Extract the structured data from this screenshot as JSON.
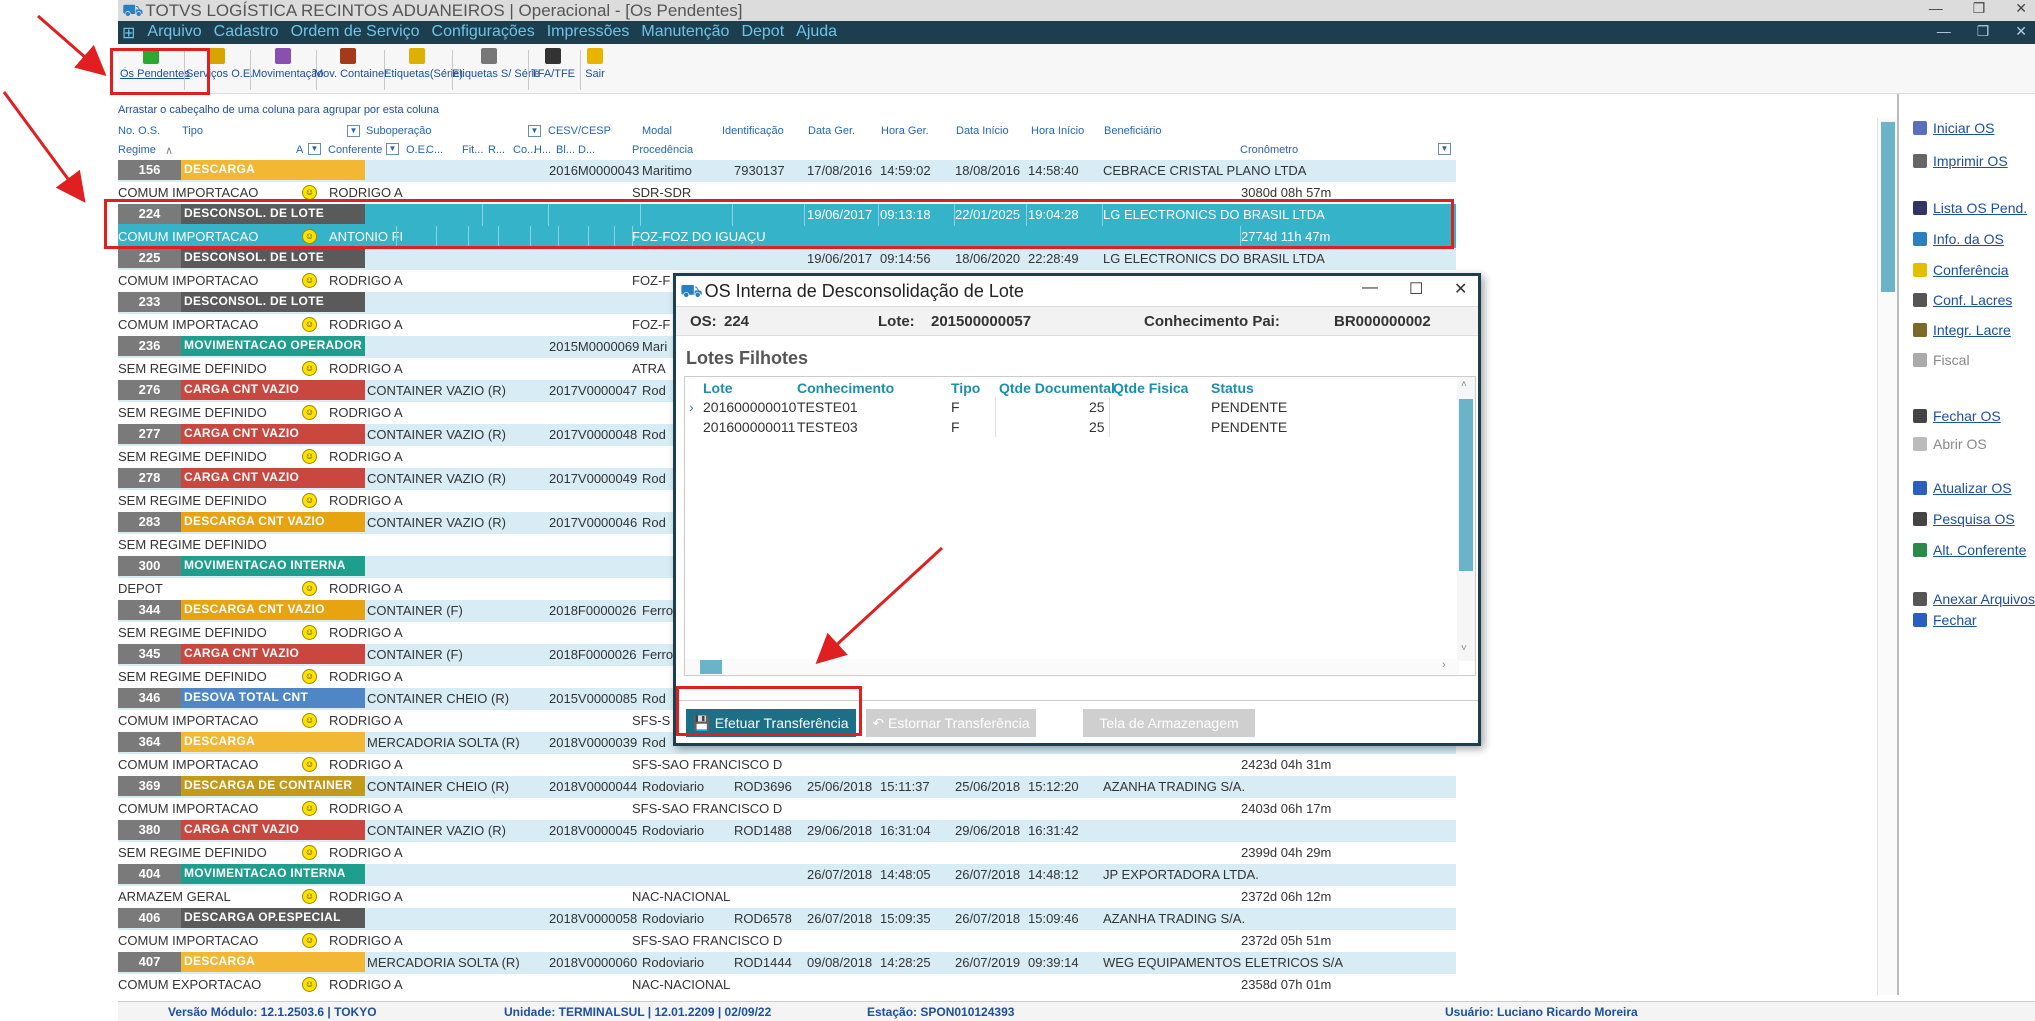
{
  "window": {
    "title": "TOTVS LOGÍSTICA RECINTOS ADUANEIROS | Operacional - [Os Pendentes]"
  },
  "menu": [
    "Arquivo",
    "Cadastro",
    "Ordem de Serviço",
    "Configurações",
    "Impressões",
    "Manutenção",
    "Depot",
    "Ajuda"
  ],
  "toolbar": [
    {
      "label": "Os Pendentes",
      "icon": "checklist-icon",
      "color": "#2aa832"
    },
    {
      "label": "Serviços O.E.",
      "icon": "services-icon",
      "color": "#d9a400"
    },
    {
      "label": "Movimentação",
      "icon": "movement-icon",
      "color": "#8a4fb0"
    },
    {
      "label": "Mov. Container",
      "icon": "container-icon",
      "color": "#a33a1a"
    },
    {
      "label": "Etiquetas(Série)",
      "icon": "label-icon",
      "color": "#e0b000"
    },
    {
      "label": "Etiquetas S/ Série",
      "icon": "printer-icon",
      "color": "#777777"
    },
    {
      "label": "TFA/TFE",
      "icon": "tfa-icon",
      "color": "#333333"
    },
    {
      "label": "Sair",
      "icon": "exit-icon",
      "color": "#e8b400"
    }
  ],
  "grid": {
    "group_hint": "Arrastar o cabeçalho de uma coluna para agrupar por esta coluna",
    "headers_top": [
      "No. O.S.",
      "Tipo",
      "Suboperação",
      "CESV/CESP",
      "Modal",
      "Identificação",
      "Data Ger.",
      "Hora Ger.",
      "Data Início",
      "Hora Início",
      "Beneficiário"
    ],
    "headers_bottom": [
      "Regime",
      "A",
      "Conferente",
      "O.E.",
      "C...",
      "Fit...",
      "R...",
      "Co...",
      "H...",
      "Bl...",
      "D...",
      "Procedência",
      "Cronômetro"
    ],
    "records": [
      {
        "num": "156",
        "tipo": "DESCARGA",
        "color": "#f2b733",
        "sub": "",
        "cesv": "2016M0000043",
        "modal": "Maritimo",
        "ident": "7930137",
        "dger": "17/08/2016",
        "hger": "14:59:02",
        "dini": "18/08/2016",
        "hini": "14:58:40",
        "benef": "CEBRACE CRISTAL PLANO LTDA",
        "regime": "COMUM IMPORTACAO",
        "smile": true,
        "conf": "RODRIGO A",
        "proc": "SDR-SDR",
        "crono": "3080d 08h 57m"
      },
      {
        "num": "224",
        "tipo": "DESCONSOL. DE LOTE",
        "color": "#5a5a5a",
        "sub": "",
        "cesv": "",
        "modal": "",
        "ident": "",
        "dger": "19/06/2017",
        "hger": "09:13:18",
        "dini": "22/01/2025",
        "hini": "19:04:28",
        "benef": "LG ELECTRONICS DO BRASIL LTDA",
        "regime": "COMUM IMPORTACAO",
        "smile": true,
        "conf": "ANTONIO FI",
        "proc": "FOZ-FOZ DO IGUAÇU",
        "crono": "2774d 11h 47m",
        "selected": true
      },
      {
        "num": "225",
        "tipo": "DESCONSOL. DE LOTE",
        "color": "#5a5a5a",
        "sub": "",
        "cesv": "",
        "modal": "",
        "ident": "",
        "dger": "19/06/2017",
        "hger": "09:14:56",
        "dini": "18/06/2020",
        "hini": "22:28:49",
        "benef": "LG ELECTRONICS DO BRASIL LTDA",
        "regime": "COMUM IMPORTACAO",
        "smile": true,
        "conf": "RODRIGO A",
        "proc": "FOZ-F",
        "crono": ""
      },
      {
        "num": "233",
        "tipo": "DESCONSOL. DE LOTE",
        "color": "#5a5a5a",
        "sub": "",
        "cesv": "",
        "modal": "",
        "ident": "",
        "dger": "",
        "hger": "",
        "dini": "",
        "hini": "",
        "benef": "",
        "regime": "COMUM IMPORTACAO",
        "smile": true,
        "conf": "RODRIGO A",
        "proc": "FOZ-F",
        "crono": ""
      },
      {
        "num": "236",
        "tipo": "MOVIMENTACAO OPERADOR",
        "color": "#1e9e8c",
        "sub": "",
        "cesv": "2015M0000069",
        "modal": "Mari",
        "ident": "",
        "dger": "",
        "hger": "",
        "dini": "",
        "hini": "",
        "benef": "",
        "regime": "SEM REGIME DEFINIDO",
        "smile": true,
        "conf": "RODRIGO A",
        "proc": "ATRA",
        "crono": ""
      },
      {
        "num": "276",
        "tipo": "CARGA CNT VAZIO",
        "color": "#c9473f",
        "sub": "CONTAINER VAZIO (R)",
        "cesv": "2017V0000047",
        "modal": "Rod",
        "ident": "",
        "dger": "",
        "hger": "",
        "dini": "",
        "hini": "",
        "benef": "",
        "regime": "SEM REGIME DEFINIDO",
        "smile": true,
        "conf": "RODRIGO A",
        "proc": "",
        "crono": ""
      },
      {
        "num": "277",
        "tipo": "CARGA CNT VAZIO",
        "color": "#c9473f",
        "sub": "CONTAINER VAZIO (R)",
        "cesv": "2017V0000048",
        "modal": "Rod",
        "ident": "",
        "dger": "",
        "hger": "",
        "dini": "",
        "hini": "",
        "benef": "",
        "regime": "SEM REGIME DEFINIDO",
        "smile": true,
        "conf": "RODRIGO A",
        "proc": "",
        "crono": ""
      },
      {
        "num": "278",
        "tipo": "CARGA CNT VAZIO",
        "color": "#c9473f",
        "sub": "CONTAINER VAZIO (R)",
        "cesv": "2017V0000049",
        "modal": "Rod",
        "ident": "",
        "dger": "",
        "hger": "",
        "dini": "",
        "hini": "",
        "benef": "",
        "regime": "SEM REGIME DEFINIDO",
        "smile": true,
        "conf": "RODRIGO A",
        "proc": "",
        "crono": ""
      },
      {
        "num": "283",
        "tipo": "DESCARGA CNT VAZIO",
        "color": "#e8a311",
        "sub": "CONTAINER VAZIO (R)",
        "cesv": "2017V0000046",
        "modal": "Rod",
        "ident": "",
        "dger": "",
        "hger": "",
        "dini": "",
        "hini": "",
        "benef": "",
        "regime": "SEM REGIME DEFINIDO",
        "smile": false,
        "conf": "",
        "proc": "",
        "crono": ""
      },
      {
        "num": "300",
        "tipo": "MOVIMENTACAO INTERNA",
        "color": "#1e9e8c",
        "sub": "",
        "cesv": "",
        "modal": "",
        "ident": "",
        "dger": "",
        "hger": "",
        "dini": "",
        "hini": "",
        "benef": "",
        "regime": "DEPOT",
        "smile": true,
        "conf": "RODRIGO A",
        "proc": "",
        "crono": ""
      },
      {
        "num": "344",
        "tipo": "DESCARGA CNT VAZIO",
        "color": "#e8a311",
        "sub": "CONTAINER (F)",
        "cesv": "2018F0000026",
        "modal": "Ferro",
        "ident": "",
        "dger": "",
        "hger": "",
        "dini": "",
        "hini": "",
        "benef": "",
        "regime": "SEM REGIME DEFINIDO",
        "smile": true,
        "conf": "RODRIGO A",
        "proc": "",
        "crono": ""
      },
      {
        "num": "345",
        "tipo": "CARGA CNT VAZIO",
        "color": "#c9473f",
        "sub": "CONTAINER (F)",
        "cesv": "2018F0000026",
        "modal": "Ferro",
        "ident": "",
        "dger": "",
        "hger": "",
        "dini": "",
        "hini": "",
        "benef": "",
        "regime": "SEM REGIME DEFINIDO",
        "smile": true,
        "conf": "RODRIGO A",
        "proc": "",
        "crono": ""
      },
      {
        "num": "346",
        "tipo": "DESOVA TOTAL CNT",
        "color": "#4f86c6",
        "sub": "CONTAINER CHEIO (R)",
        "cesv": "2015V0000085",
        "modal": "Rod",
        "ident": "",
        "dger": "",
        "hger": "",
        "dini": "",
        "hini": "",
        "benef": "",
        "regime": "COMUM IMPORTACAO",
        "smile": true,
        "conf": "RODRIGO A",
        "proc": "SFS-S",
        "crono": ""
      },
      {
        "num": "364",
        "tipo": "DESCARGA",
        "color": "#f2b733",
        "sub": "MERCADORIA SOLTA (R)",
        "cesv": "2018V0000039",
        "modal": "Rod",
        "ident": "",
        "dger": "",
        "hger": "",
        "dini": "",
        "hini": "",
        "benef": "",
        "regime": "COMUM IMPORTACAO",
        "smile": true,
        "conf": "RODRIGO A",
        "proc": "SFS-SAO FRANCISCO D",
        "crono": "2423d 04h 31m"
      },
      {
        "num": "369",
        "tipo": "DESCARGA DE CONTAINER",
        "color": "#c49a1a",
        "sub": "CONTAINER CHEIO (R)",
        "cesv": "2018V0000044",
        "modal": "Rodoviario",
        "ident": "ROD3696",
        "dger": "25/06/2018",
        "hger": "15:11:37",
        "dini": "25/06/2018",
        "hini": "15:12:20",
        "benef": "AZANHA TRADING S/A.",
        "regime": "COMUM IMPORTACAO",
        "smile": true,
        "conf": "RODRIGO A",
        "proc": "SFS-SAO FRANCISCO D",
        "crono": "2403d 06h 17m"
      },
      {
        "num": "380",
        "tipo": "CARGA CNT VAZIO",
        "color": "#c9473f",
        "sub": "CONTAINER VAZIO (R)",
        "cesv": "2018V0000045",
        "modal": "Rodoviario",
        "ident": "ROD1488",
        "dger": "29/06/2018",
        "hger": "16:31:04",
        "dini": "29/06/2018",
        "hini": "16:31:42",
        "benef": "",
        "regime": "SEM REGIME DEFINIDO",
        "smile": true,
        "conf": "RODRIGO A",
        "proc": "",
        "crono": "2399d 04h 29m"
      },
      {
        "num": "404",
        "tipo": "MOVIMENTACAO INTERNA",
        "color": "#1e9e8c",
        "sub": "",
        "cesv": "",
        "modal": "",
        "ident": "",
        "dger": "26/07/2018",
        "hger": "14:48:05",
        "dini": "26/07/2018",
        "hini": "14:48:12",
        "benef": "JP EXPORTADORA LTDA.",
        "regime": "ARMAZEM GERAL",
        "smile": true,
        "conf": "RODRIGO A",
        "proc": "NAC-NACIONAL",
        "crono": "2372d 06h 12m"
      },
      {
        "num": "406",
        "tipo": "DESCARGA OP.ESPECIAL",
        "color": "#5a5a5a",
        "sub": "",
        "cesv": "2018V0000058",
        "modal": "Rodoviario",
        "ident": "ROD6578",
        "dger": "26/07/2018",
        "hger": "15:09:35",
        "dini": "26/07/2018",
        "hini": "15:09:46",
        "benef": "AZANHA TRADING S/A.",
        "regime": "COMUM IMPORTACAO",
        "smile": true,
        "conf": "RODRIGO A",
        "proc": "SFS-SAO FRANCISCO D",
        "crono": "2372d 05h 51m"
      },
      {
        "num": "407",
        "tipo": "DESCARGA",
        "color": "#f2b733",
        "sub": "MERCADORIA SOLTA (R)",
        "cesv": "2018V0000060",
        "modal": "Rodoviario",
        "ident": "ROD1444",
        "dger": "09/08/2018",
        "hger": "14:28:25",
        "dini": "26/07/2019",
        "hini": "09:39:14",
        "benef": "WEG EQUIPAMENTOS ELETRICOS S/A",
        "regime": "COMUM EXPORTACAO",
        "smile": true,
        "conf": "RODRIGO A",
        "proc": "NAC-NACIONAL",
        "crono": "2358d 07h 01m"
      }
    ]
  },
  "sidepanel": [
    {
      "label": "Iniciar OS",
      "icon": "start-icon",
      "enabled": true,
      "color": "#5b6fbf"
    },
    {
      "label": "Imprimir OS",
      "icon": "printer-icon",
      "enabled": true,
      "color": "#666666"
    },
    {
      "label": "Lista OS Pend.",
      "icon": "list-icon",
      "enabled": true,
      "color": "#333366"
    },
    {
      "label": "Info. da OS",
      "icon": "info-icon",
      "enabled": true,
      "color": "#2a7fc1"
    },
    {
      "label": "Conferência",
      "icon": "shield-icon",
      "enabled": true,
      "color": "#e0c000"
    },
    {
      "label": "Conf. Lacres",
      "icon": "seal-icon",
      "enabled": true,
      "color": "#555555"
    },
    {
      "label": "Integr. Lacre",
      "icon": "integration-icon",
      "enabled": true,
      "color": "#7a6a2a"
    },
    {
      "label": "Fiscal",
      "icon": "fiscal-icon",
      "enabled": false,
      "color": "#aaaaaa"
    },
    {
      "label": "Fechar OS",
      "icon": "close-os-icon",
      "enabled": true,
      "color": "#444444"
    },
    {
      "label": "Abrir OS",
      "icon": "open-os-icon",
      "enabled": false,
      "color": "#bbbbbb"
    },
    {
      "label": "Atualizar OS",
      "icon": "refresh-icon",
      "enabled": true,
      "color": "#2a5fc1"
    },
    {
      "label": "Pesquisa OS",
      "icon": "search-icon",
      "enabled": true,
      "color": "#444444"
    },
    {
      "label": "Alt. Conferente",
      "icon": "user-edit-icon",
      "enabled": true,
      "color": "#2a8a4a"
    },
    {
      "label": "Anexar Arquivos",
      "icon": "attach-icon",
      "enabled": true,
      "color": "#555555"
    },
    {
      "label": "Fechar",
      "icon": "back-icon",
      "enabled": true,
      "color": "#2a5fc1"
    }
  ],
  "status": {
    "versao": "Versão Módulo:  12.1.2503.6  |  TOKYO",
    "unidade": "Unidade:  TERMINALSUL | 12.01.2209 | 02/09/22",
    "estacao": "Estação:  SPON010124393",
    "usuario": "Usuário:  Luciano Ricardo Moreira"
  },
  "dialog": {
    "title": "OS Interna de Desconsolidação de Lote",
    "os_label": "OS:",
    "os_value": "224",
    "lote_label": "Lote:",
    "lote_value": "201500000057",
    "conh_label": "Conhecimento Pai:",
    "conh_value": "BR000000002",
    "section_title": "Lotes Filhotes",
    "columns": [
      "Lote",
      "Conhecimento",
      "Tipo",
      "Qtde Documental",
      "Qtde Fisica",
      "Status"
    ],
    "rows": [
      {
        "lote": "201600000010",
        "conh": "TESTE01",
        "tipo": "F",
        "qtde_doc": "25",
        "qtde_fis": "",
        "status": "PENDENTE",
        "current": true
      },
      {
        "lote": "201600000011",
        "conh": "TESTE03",
        "tipo": "F",
        "qtde_doc": "25",
        "qtde_fis": "",
        "status": "PENDENTE",
        "current": false
      }
    ],
    "btn_efetuar": "Efetuar Transferência",
    "btn_estornar": "Estornar Transferência",
    "btn_tela": "Tela de Armazenagem"
  },
  "colors": {
    "menubar": "#1d3e4f",
    "menu_text": "#6fc3e6",
    "selection": "#35b3c9",
    "alt_row": "#d8ecf5",
    "link": "#1b4fa0",
    "primary_button": "#1d6e87",
    "annotation": "#e02020"
  }
}
